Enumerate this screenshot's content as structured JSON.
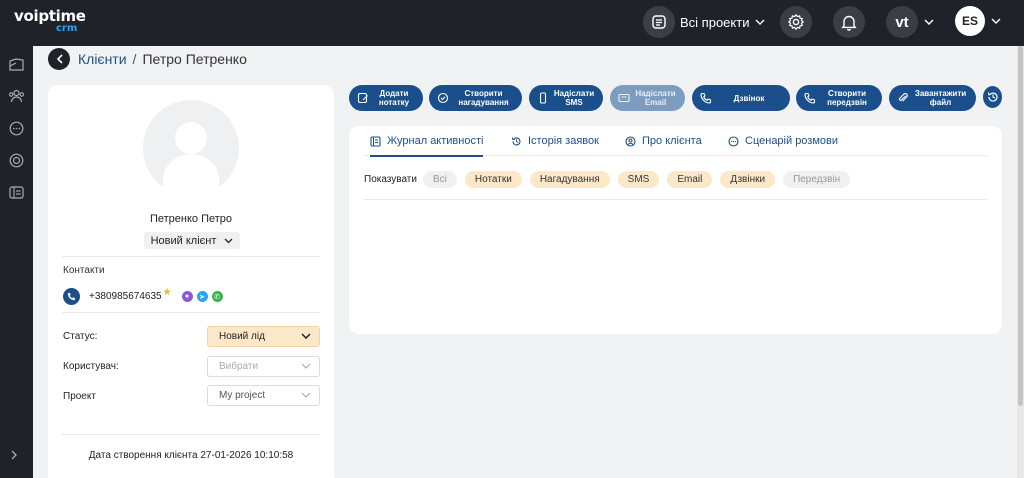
{
  "app": {
    "logo_text": "voiptime",
    "logo_sub": "crm"
  },
  "topbar": {
    "projects_label": "Всі проекти",
    "vt_label": "vt",
    "user_initials": "ES"
  },
  "breadcrumb": {
    "link": "Клієнти",
    "separator": "/",
    "current": "Петро Петренко"
  },
  "client": {
    "name": "Петренко Петро",
    "stage": "Новий клієнт",
    "contacts_title": "Контакти",
    "phone": "+380985674635",
    "star": "★",
    "fields": [
      {
        "label": "Статус:",
        "value": "Новий лід"
      },
      {
        "label": "Користувач:",
        "value": "Вибрати"
      },
      {
        "label": "Проект",
        "value": "My project"
      }
    ],
    "created": "Дата створення клієнта 27-01-2026 10:10:58"
  },
  "actions": [
    {
      "label": "Додати нотатку"
    },
    {
      "label": "Створити нагадування"
    },
    {
      "label": "Надіслати SMS"
    },
    {
      "label": "Надіслати Email"
    },
    {
      "label": "Дзвінок"
    },
    {
      "label": "Створити передзвін"
    },
    {
      "label": "Завантажити файл"
    }
  ],
  "tabs": [
    {
      "label": "Журнал активності"
    },
    {
      "label": "Історія заявок"
    },
    {
      "label": "Про клієнта"
    },
    {
      "label": "Сценарій розмови"
    }
  ],
  "filters": {
    "label": "Показувати",
    "chips": [
      "Всі",
      "Нотатки",
      "Нагадування",
      "SMS",
      "Email",
      "Дзвінки",
      "Передзвін"
    ]
  },
  "colors": {
    "dark": "#1f2329",
    "primary": "#1b4f8b",
    "accent_orange": "#fbe8c8",
    "logo_blue": "#2aa3f0"
  }
}
